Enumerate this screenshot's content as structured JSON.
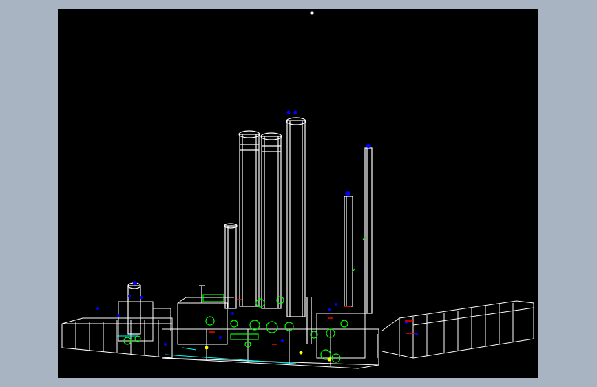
{
  "colors": {
    "window_background": "#a9b4c2",
    "viewport_background": "#000000",
    "wireframe": "#ffffff",
    "equipment_green": "#00ff00",
    "nozzle_blue": "#0000ff",
    "pipe_red": "#ff0000",
    "cyan": "#00ffff",
    "yellow": "#ffff00"
  },
  "viewport": {
    "view_mode": "3d-wireframe",
    "content": "process-plant-model"
  },
  "icons": [
    "ucs-origin-marker-icon"
  ]
}
